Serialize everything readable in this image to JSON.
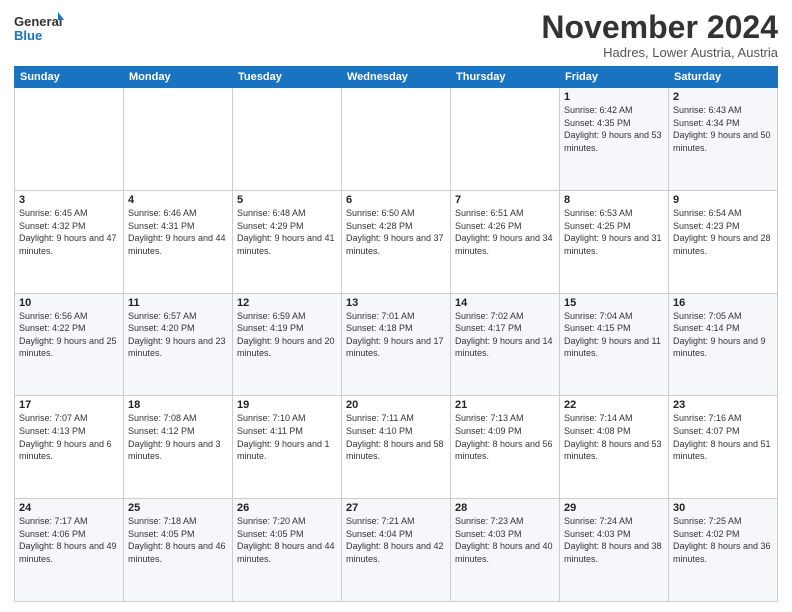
{
  "logo": {
    "line1": "General",
    "line2": "Blue"
  },
  "title": "November 2024",
  "subtitle": "Hadres, Lower Austria, Austria",
  "weekdays": [
    "Sunday",
    "Monday",
    "Tuesday",
    "Wednesday",
    "Thursday",
    "Friday",
    "Saturday"
  ],
  "weeks": [
    [
      {
        "day": "",
        "info": ""
      },
      {
        "day": "",
        "info": ""
      },
      {
        "day": "",
        "info": ""
      },
      {
        "day": "",
        "info": ""
      },
      {
        "day": "",
        "info": ""
      },
      {
        "day": "1",
        "info": "Sunrise: 6:42 AM\nSunset: 4:35 PM\nDaylight: 9 hours and 53 minutes."
      },
      {
        "day": "2",
        "info": "Sunrise: 6:43 AM\nSunset: 4:34 PM\nDaylight: 9 hours and 50 minutes."
      }
    ],
    [
      {
        "day": "3",
        "info": "Sunrise: 6:45 AM\nSunset: 4:32 PM\nDaylight: 9 hours and 47 minutes."
      },
      {
        "day": "4",
        "info": "Sunrise: 6:46 AM\nSunset: 4:31 PM\nDaylight: 9 hours and 44 minutes."
      },
      {
        "day": "5",
        "info": "Sunrise: 6:48 AM\nSunset: 4:29 PM\nDaylight: 9 hours and 41 minutes."
      },
      {
        "day": "6",
        "info": "Sunrise: 6:50 AM\nSunset: 4:28 PM\nDaylight: 9 hours and 37 minutes."
      },
      {
        "day": "7",
        "info": "Sunrise: 6:51 AM\nSunset: 4:26 PM\nDaylight: 9 hours and 34 minutes."
      },
      {
        "day": "8",
        "info": "Sunrise: 6:53 AM\nSunset: 4:25 PM\nDaylight: 9 hours and 31 minutes."
      },
      {
        "day": "9",
        "info": "Sunrise: 6:54 AM\nSunset: 4:23 PM\nDaylight: 9 hours and 28 minutes."
      }
    ],
    [
      {
        "day": "10",
        "info": "Sunrise: 6:56 AM\nSunset: 4:22 PM\nDaylight: 9 hours and 25 minutes."
      },
      {
        "day": "11",
        "info": "Sunrise: 6:57 AM\nSunset: 4:20 PM\nDaylight: 9 hours and 23 minutes."
      },
      {
        "day": "12",
        "info": "Sunrise: 6:59 AM\nSunset: 4:19 PM\nDaylight: 9 hours and 20 minutes."
      },
      {
        "day": "13",
        "info": "Sunrise: 7:01 AM\nSunset: 4:18 PM\nDaylight: 9 hours and 17 minutes."
      },
      {
        "day": "14",
        "info": "Sunrise: 7:02 AM\nSunset: 4:17 PM\nDaylight: 9 hours and 14 minutes."
      },
      {
        "day": "15",
        "info": "Sunrise: 7:04 AM\nSunset: 4:15 PM\nDaylight: 9 hours and 11 minutes."
      },
      {
        "day": "16",
        "info": "Sunrise: 7:05 AM\nSunset: 4:14 PM\nDaylight: 9 hours and 9 minutes."
      }
    ],
    [
      {
        "day": "17",
        "info": "Sunrise: 7:07 AM\nSunset: 4:13 PM\nDaylight: 9 hours and 6 minutes."
      },
      {
        "day": "18",
        "info": "Sunrise: 7:08 AM\nSunset: 4:12 PM\nDaylight: 9 hours and 3 minutes."
      },
      {
        "day": "19",
        "info": "Sunrise: 7:10 AM\nSunset: 4:11 PM\nDaylight: 9 hours and 1 minute."
      },
      {
        "day": "20",
        "info": "Sunrise: 7:11 AM\nSunset: 4:10 PM\nDaylight: 8 hours and 58 minutes."
      },
      {
        "day": "21",
        "info": "Sunrise: 7:13 AM\nSunset: 4:09 PM\nDaylight: 8 hours and 56 minutes."
      },
      {
        "day": "22",
        "info": "Sunrise: 7:14 AM\nSunset: 4:08 PM\nDaylight: 8 hours and 53 minutes."
      },
      {
        "day": "23",
        "info": "Sunrise: 7:16 AM\nSunset: 4:07 PM\nDaylight: 8 hours and 51 minutes."
      }
    ],
    [
      {
        "day": "24",
        "info": "Sunrise: 7:17 AM\nSunset: 4:06 PM\nDaylight: 8 hours and 49 minutes."
      },
      {
        "day": "25",
        "info": "Sunrise: 7:18 AM\nSunset: 4:05 PM\nDaylight: 8 hours and 46 minutes."
      },
      {
        "day": "26",
        "info": "Sunrise: 7:20 AM\nSunset: 4:05 PM\nDaylight: 8 hours and 44 minutes."
      },
      {
        "day": "27",
        "info": "Sunrise: 7:21 AM\nSunset: 4:04 PM\nDaylight: 8 hours and 42 minutes."
      },
      {
        "day": "28",
        "info": "Sunrise: 7:23 AM\nSunset: 4:03 PM\nDaylight: 8 hours and 40 minutes."
      },
      {
        "day": "29",
        "info": "Sunrise: 7:24 AM\nSunset: 4:03 PM\nDaylight: 8 hours and 38 minutes."
      },
      {
        "day": "30",
        "info": "Sunrise: 7:25 AM\nSunset: 4:02 PM\nDaylight: 8 hours and 36 minutes."
      }
    ]
  ]
}
